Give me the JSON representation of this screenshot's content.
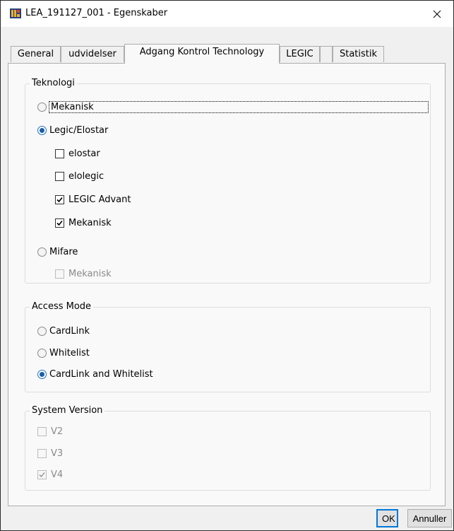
{
  "window": {
    "title": "LEA_191127_001 - Egenskaber",
    "close_glyph": "✕"
  },
  "tabs": [
    {
      "label": "General",
      "active": false
    },
    {
      "label": "udvidelser",
      "active": false
    },
    {
      "label": "Adgang Kontrol Technology",
      "active": true
    },
    {
      "label": "LEGIC",
      "active": false
    },
    {
      "label": "",
      "active": false
    },
    {
      "label": "Statistik",
      "active": false
    }
  ],
  "teknologi": {
    "title": "Teknologi",
    "mekanisk": {
      "label": "Mekanisk",
      "checked": false
    },
    "legic_elostar": {
      "label": "Legic/Elostar",
      "checked": true
    },
    "elostar": {
      "label": "elostar",
      "checked": false
    },
    "elolegic": {
      "label": "elolegic",
      "checked": false
    },
    "legic_advant": {
      "label": "LEGIC Advant",
      "checked": true
    },
    "legic_mekanisk": {
      "label": "Mekanisk",
      "checked": true
    },
    "mifare": {
      "label": "Mifare",
      "checked": false
    },
    "mifare_mekanisk": {
      "label": "Mekanisk",
      "checked": false,
      "disabled": true
    }
  },
  "access_mode": {
    "title": "Access Mode",
    "cardlink": {
      "label": "CardLink",
      "checked": false
    },
    "whitelist": {
      "label": "Whitelist",
      "checked": false
    },
    "cardlink_whitelist": {
      "label": "CardLink and Whitelist",
      "checked": true
    }
  },
  "system_version": {
    "title": "System Version",
    "v2": {
      "label": "V2",
      "checked": false,
      "disabled": true
    },
    "v3": {
      "label": "V3",
      "checked": false,
      "disabled": true
    },
    "v4": {
      "label": "V4",
      "checked": true,
      "disabled": true
    }
  },
  "buttons": {
    "ok": "OK",
    "cancel": "Annuller"
  },
  "colors": {
    "accent": "#0078d7",
    "radio_dot": "#1a5ea8"
  }
}
